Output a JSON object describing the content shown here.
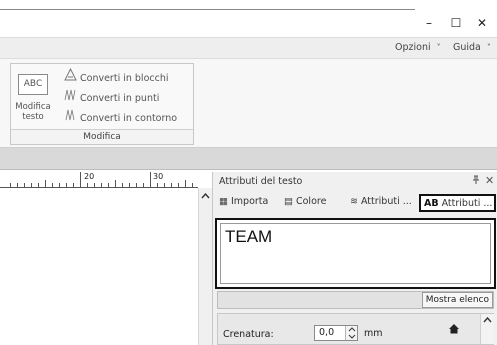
{
  "window": {
    "minimize_glyph": "–",
    "maximize_glyph": "☐",
    "close_glyph": "✕"
  },
  "menu": {
    "opzioni": "Opzioni",
    "guida": "Guida",
    "dropdown_glyph": "˅"
  },
  "ribbon": {
    "group": {
      "abc_label": "ABC",
      "modifica_testo_line1": "Modifica",
      "modifica_testo_line2": "testo",
      "converti_blocchi": "Converti in blocchi",
      "converti_punti": "Converti in punti",
      "converti_contorno": "Converti in contorno",
      "group_title": "Modifica"
    }
  },
  "ruler": {
    "label_20": "20",
    "label_30": "30"
  },
  "panel": {
    "title": "Attributi del testo",
    "pin_glyph": "ᵖ",
    "close_glyph": "✕",
    "tabs": [
      {
        "icon": "▦",
        "label": "Importa"
      },
      {
        "icon": "▤",
        "label": "Colore"
      },
      {
        "icon": "≋",
        "label": "Attributi ..."
      },
      {
        "icon": "AB",
        "label": "Attributi ..."
      }
    ],
    "text_value": "TEAM",
    "mostra_elenco": "Mostra elenco",
    "crenatura_label": "Crenatura:",
    "crenatura_value": "0,0",
    "crenatura_unit": "mm"
  },
  "icons": {
    "abc": "abc-text-icon",
    "blocks": "convert-blocks-icon",
    "points": "convert-points-icon",
    "outline": "convert-outline-icon",
    "home": "home-icon"
  }
}
